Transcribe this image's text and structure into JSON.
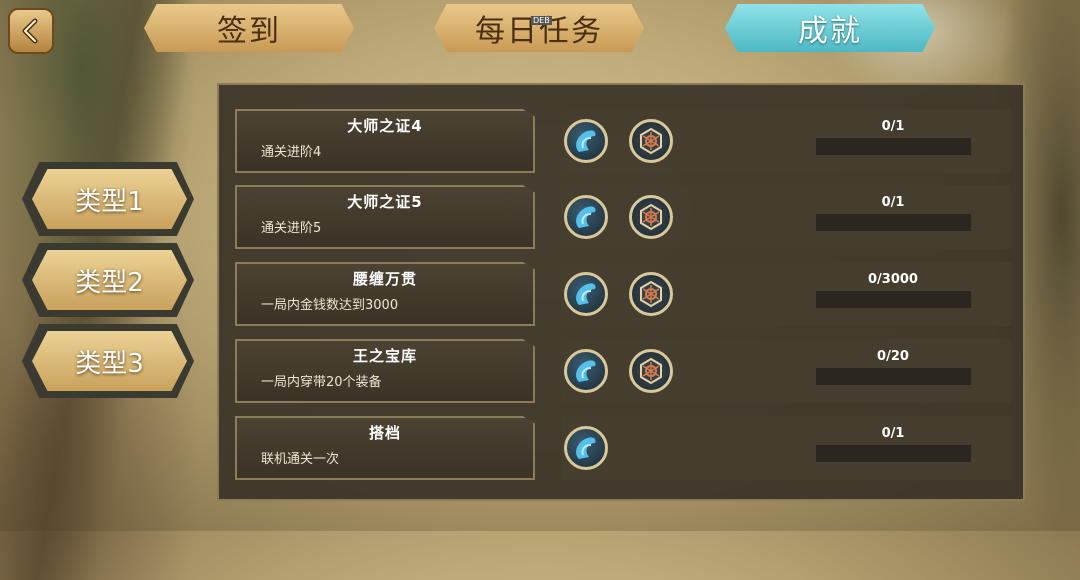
{
  "tabs": [
    {
      "label": "签到",
      "active": false
    },
    {
      "label": "每日任务",
      "active": false,
      "badge": "DEB"
    },
    {
      "label": "成就",
      "active": true
    }
  ],
  "back_icon": "chevron-left-icon",
  "categories": [
    {
      "label": "类型1"
    },
    {
      "label": "类型2"
    },
    {
      "label": "类型3"
    }
  ],
  "achievements": [
    {
      "name": "大师之证4",
      "desc": "通关进阶4",
      "progress_text": "0/1",
      "progress": 0,
      "rewards": [
        "water-drop-icon",
        "snowflake-emblem-icon"
      ]
    },
    {
      "name": "大师之证5",
      "desc": "通关进阶5",
      "progress_text": "0/1",
      "progress": 0,
      "rewards": [
        "water-drop-icon",
        "snowflake-emblem-icon"
      ]
    },
    {
      "name": "腰缠万贯",
      "desc": "一局内金钱数达到3000",
      "progress_text": "0/3000",
      "progress": 0,
      "rewards": [
        "water-drop-icon",
        "snowflake-emblem-icon"
      ]
    },
    {
      "name": "王之宝库",
      "desc": "一局内穿带20个装备",
      "progress_text": "0/20",
      "progress": 0,
      "rewards": [
        "water-drop-icon",
        "snowflake-emblem-icon"
      ]
    },
    {
      "name": "搭档",
      "desc": "联机通关一次",
      "progress_text": "0/1",
      "progress": 0,
      "rewards": [
        "water-drop-icon"
      ]
    }
  ],
  "colors": {
    "tab_gold": "#d8b06e",
    "tab_active": "#5cc6cf",
    "panel": "#3a3428",
    "progress_fill": "#c9a24e"
  }
}
